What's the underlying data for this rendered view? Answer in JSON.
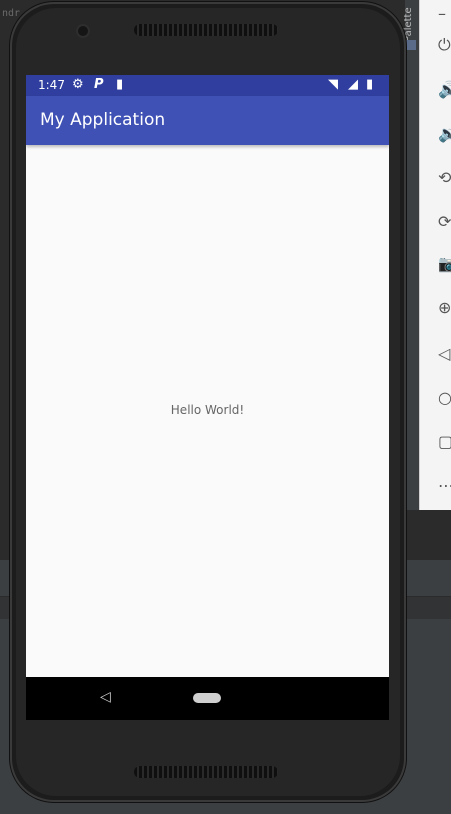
{
  "ide": {
    "code_hint": "ndr",
    "palette_label": "Palette"
  },
  "emulator_toolbar": {
    "items": [
      {
        "name": "minimize",
        "glyph": "–"
      },
      {
        "name": "power",
        "glyph": "⏻"
      },
      {
        "name": "volume-up",
        "glyph": "🔊"
      },
      {
        "name": "volume-down",
        "glyph": "🔉"
      },
      {
        "name": "rotate-left",
        "glyph": "⟲"
      },
      {
        "name": "rotate-right",
        "glyph": "⟳"
      },
      {
        "name": "screenshot",
        "glyph": "📷"
      },
      {
        "name": "zoom",
        "glyph": "⊕"
      },
      {
        "name": "back",
        "glyph": "◁"
      },
      {
        "name": "home",
        "glyph": "○"
      },
      {
        "name": "overview",
        "glyph": "▢"
      },
      {
        "name": "more",
        "glyph": "⋯"
      }
    ]
  },
  "status_bar": {
    "time": "1:47",
    "left_icons": [
      "gear-icon",
      "parking-icon",
      "sd-card-icon"
    ],
    "right_icons": [
      "wifi-icon",
      "signal-icon",
      "battery-icon"
    ]
  },
  "app_bar": {
    "title": "My Application"
  },
  "content": {
    "text": "Hello World!"
  },
  "nav_bar": {
    "back_glyph": "◁"
  },
  "colors": {
    "status_bar": "#303f9f",
    "app_bar": "#3f51b5",
    "screen_bg": "#fafafa",
    "nav_bar": "#000000"
  }
}
